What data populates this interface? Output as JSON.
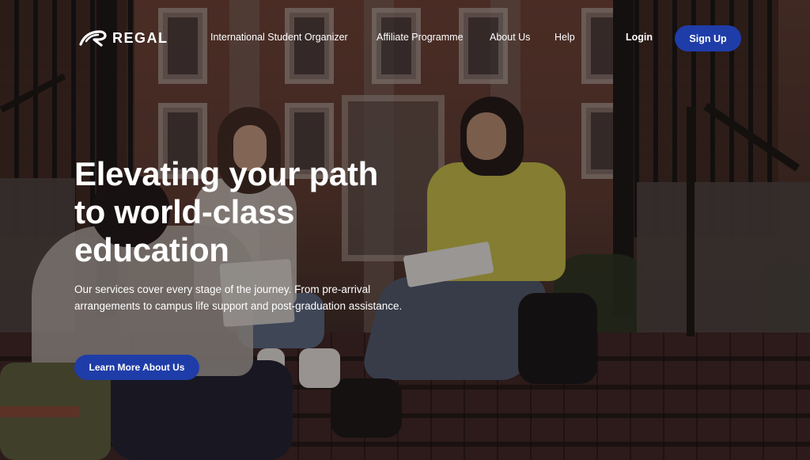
{
  "brand": {
    "name": "REGAL",
    "logo_icon": "swoosh-logo-icon"
  },
  "nav": {
    "links": [
      {
        "label": "International Student Organizer"
      },
      {
        "label": "Affiliate Programme"
      },
      {
        "label": "About Us"
      },
      {
        "label": "Help"
      }
    ],
    "login_label": "Login",
    "signup_label": "Sign Up"
  },
  "hero": {
    "headline": "Elevating your path to world-class education",
    "subtext": "Our services cover every stage of the journey. From pre-arrival arrangements to campus life support and post-graduation assistance.",
    "cta_label": "Learn More About Us",
    "background_image": "students-sitting-on-campus-steps-photo"
  },
  "colors": {
    "accent": "#1f3da8",
    "text": "#ffffff"
  }
}
